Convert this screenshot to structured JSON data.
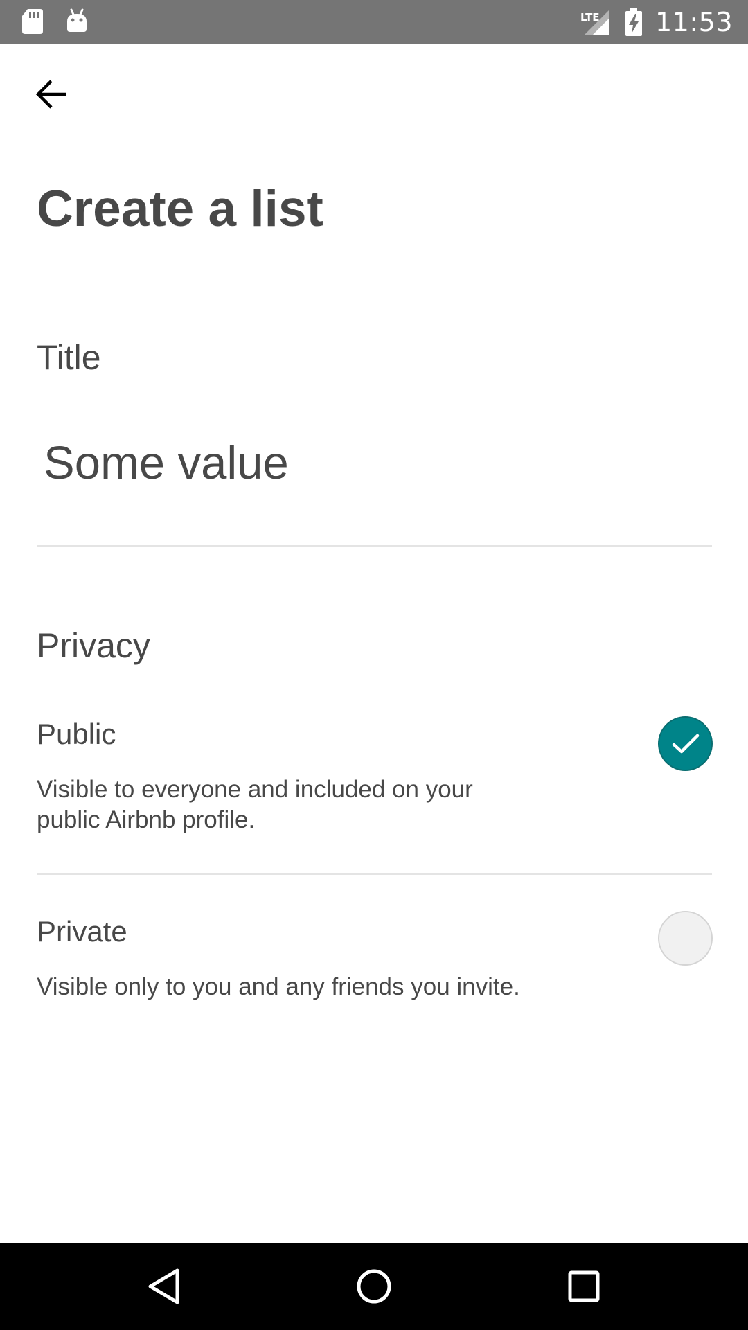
{
  "status_bar": {
    "time": "11:53",
    "left_icons": [
      "sd-card-icon",
      "android-icon"
    ],
    "right_icons": [
      "lte-signal-icon",
      "battery-charging-icon"
    ],
    "lte_label": "LTE"
  },
  "header": {
    "back_icon": "arrow-left-icon",
    "title": "Create a list"
  },
  "form": {
    "title_label": "Title",
    "title_value": "Some value",
    "privacy_label": "Privacy",
    "options": [
      {
        "id": "public",
        "label": "Public",
        "description": "Visible to everyone and included on your public Airbnb profile.",
        "selected": true
      },
      {
        "id": "private",
        "label": "Private",
        "description": "Visible only to you and any friends you invite.",
        "selected": false
      }
    ]
  },
  "nav_bar": {
    "buttons": [
      "back-triangle-icon",
      "home-circle-icon",
      "recents-square-icon"
    ]
  },
  "colors": {
    "accent": "#008489",
    "text": "#484848",
    "status_bar": "#757575",
    "nav_bar": "#000000",
    "divider": "#e4e4e4"
  }
}
